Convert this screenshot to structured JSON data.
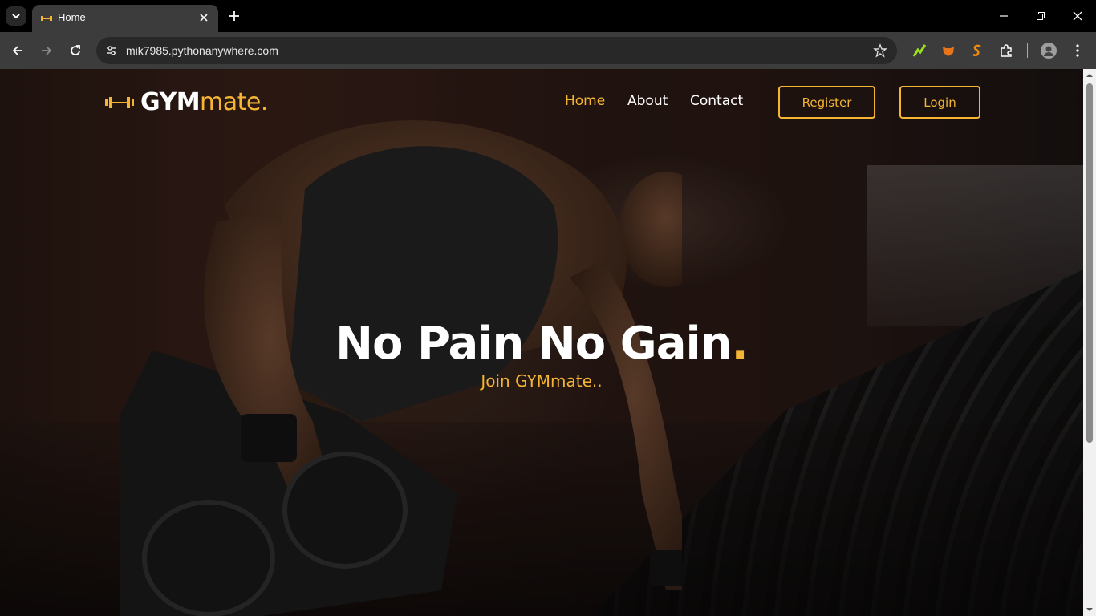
{
  "browser": {
    "tab_title": "Home",
    "url": "mik7985.pythonanywhere.com"
  },
  "colors": {
    "accent": "#f5b533",
    "chrome_dark": "#000000",
    "chrome_toolbar": "#3c3c3c"
  },
  "site": {
    "logo_gym": "GYM",
    "logo_mate": "mate.",
    "nav": [
      {
        "label": "Home",
        "active": true
      },
      {
        "label": "About",
        "active": false
      },
      {
        "label": "Contact",
        "active": false
      }
    ],
    "register_label": "Register",
    "login_label": "Login"
  },
  "hero": {
    "title": "No Pain No Gain",
    "title_dot": ".",
    "subtitle": "Join GYMmate.."
  },
  "icons": {
    "tab_search": "chevron-down-icon",
    "tab_close": "close-icon",
    "new_tab": "plus-icon",
    "back": "arrow-left-icon",
    "forward": "arrow-right-icon",
    "reload": "reload-icon",
    "site_info": "tune-icon",
    "bookmark": "star-icon",
    "extensions": "puzzle-icon",
    "menu": "more-vert-icon",
    "logo": "dumbbell-icon"
  }
}
